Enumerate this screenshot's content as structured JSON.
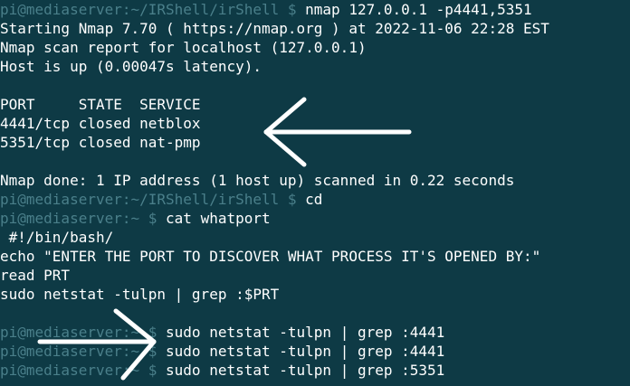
{
  "colors": {
    "background": "#0e3a45",
    "text": "#ffffff",
    "prompt": "#4a7f8a",
    "arrow": "#ffffff"
  },
  "lines": [
    {
      "type": "prompt",
      "user": "pi@mediaserver",
      "path": ":~/IRShell/irShell $ ",
      "cmd": "nmap 127.0.0.1 -p4441,5351"
    },
    {
      "type": "text",
      "text": "Starting Nmap 7.70 ( https://nmap.org ) at 2022-11-06 22:28 EST"
    },
    {
      "type": "text",
      "text": "Nmap scan report for localhost (127.0.0.1)"
    },
    {
      "type": "text",
      "text": "Host is up (0.00047s latency)."
    },
    {
      "type": "blank",
      "text": ""
    },
    {
      "type": "text",
      "text": "PORT     STATE  SERVICE"
    },
    {
      "type": "text",
      "text": "4441/tcp closed netblox"
    },
    {
      "type": "text",
      "text": "5351/tcp closed nat-pmp"
    },
    {
      "type": "blank",
      "text": ""
    },
    {
      "type": "text",
      "text": "Nmap done: 1 IP address (1 host up) scanned in 0.22 seconds"
    },
    {
      "type": "prompt",
      "user": "pi@mediaserver",
      "path": ":~/IRShell/irShell $ ",
      "cmd": "cd"
    },
    {
      "type": "prompt",
      "user": "pi@mediaserver",
      "path": ":~ $ ",
      "cmd": "cat whatport"
    },
    {
      "type": "text",
      "text": " #!/bin/bash/"
    },
    {
      "type": "text",
      "text": "echo \"ENTER THE PORT TO DISCOVER WHAT PROCESS IT'S OPENED BY:\""
    },
    {
      "type": "text",
      "text": "read PRT"
    },
    {
      "type": "text",
      "text": "sudo netstat -tulpn | grep :$PRT"
    },
    {
      "type": "blank",
      "text": ""
    },
    {
      "type": "prompt",
      "user": "pi@mediaserver",
      "path": ":~ $ ",
      "cmd": "sudo netstat -tulpn | grep :4441"
    },
    {
      "type": "prompt",
      "user": "pi@mediaserver",
      "path": ":~ $ ",
      "cmd": "sudo netstat -tulpn | grep :4441"
    },
    {
      "type": "prompt",
      "user": "pi@mediaserver",
      "path": ":~ $ ",
      "cmd": "sudo netstat -tulpn | grep :5351"
    }
  ],
  "annotations": [
    {
      "icon": "left-arrow-icon",
      "direction": "left"
    },
    {
      "icon": "right-arrow-icon",
      "direction": "right"
    }
  ]
}
